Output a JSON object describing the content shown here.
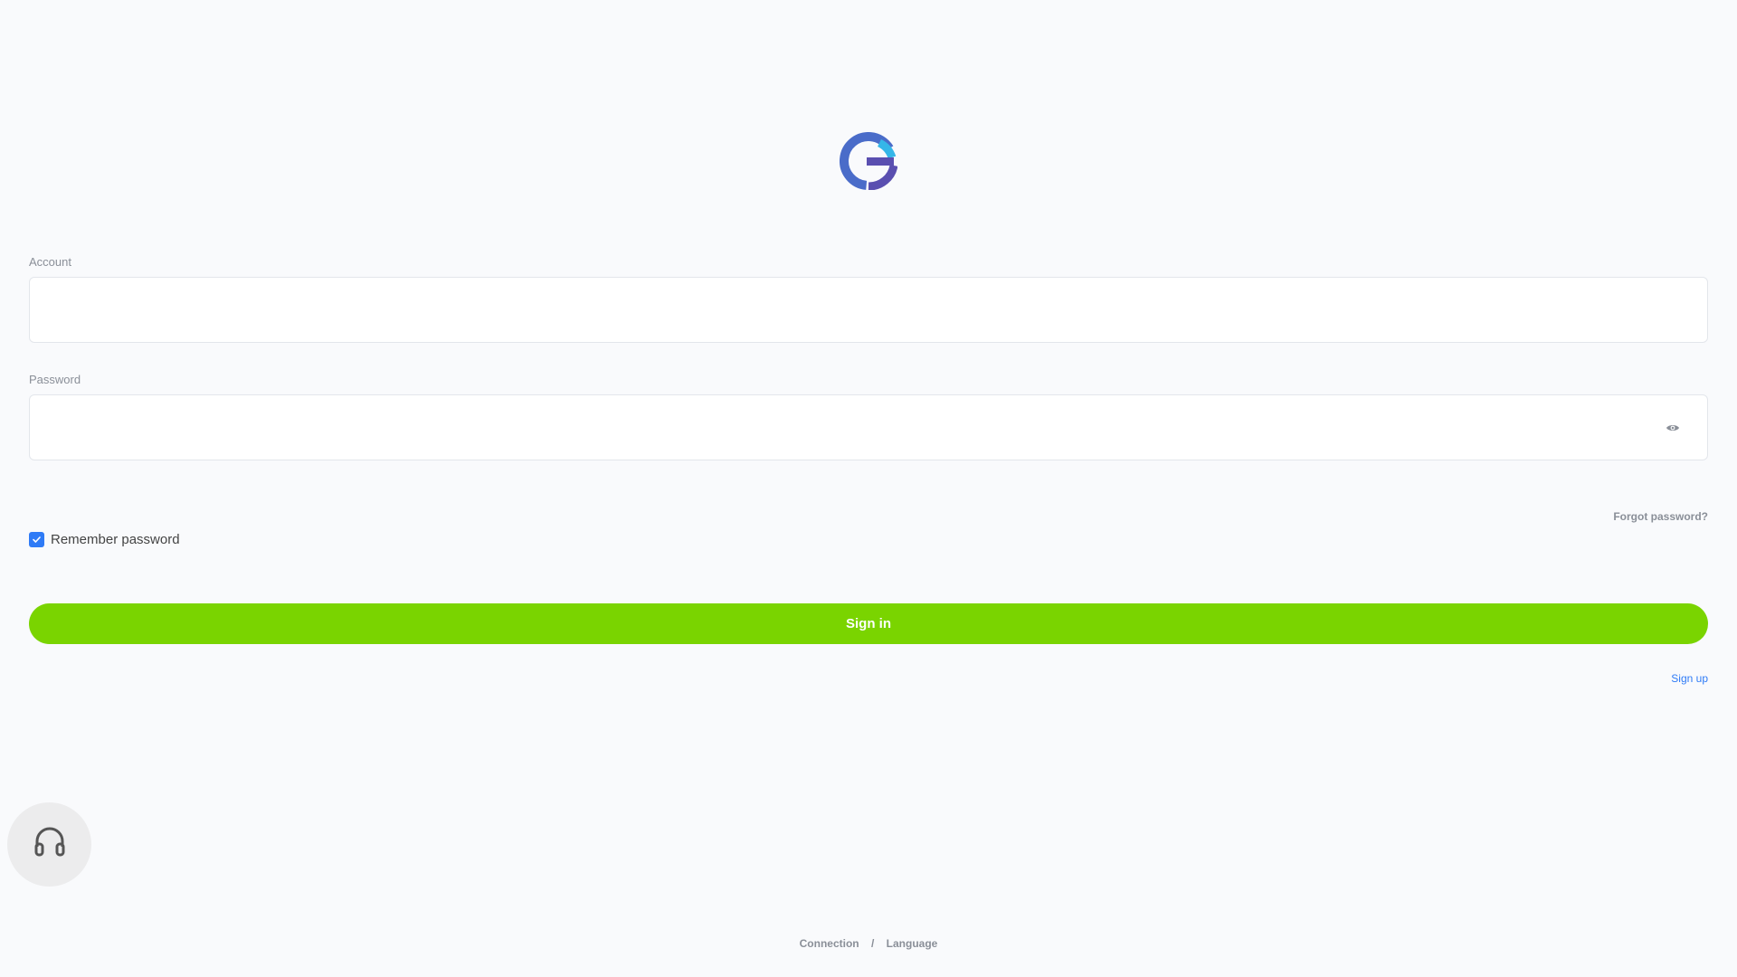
{
  "brand": {
    "logo_icon": "g-logo-icon",
    "colors": {
      "blue": "#4a6cc9",
      "cyan": "#35b6e8",
      "purple": "#5a4fb0"
    }
  },
  "login": {
    "account": {
      "label": "Account",
      "value": "",
      "placeholder": ""
    },
    "password": {
      "label": "Password",
      "value": "",
      "placeholder": "",
      "toggle_icon": "eye-icon"
    },
    "forgot_password": "Forgot password?",
    "remember_password": {
      "label": "Remember password",
      "checked": true
    },
    "sign_in": "Sign in",
    "sign_up": "Sign up"
  },
  "support": {
    "icon": "headphones-icon"
  },
  "footer": {
    "connection": "Connection",
    "separator": "/",
    "language": "Language"
  },
  "colors": {
    "background": "#f9fafc",
    "accent_green": "#7ad400",
    "accent_blue": "#2f7bf6",
    "muted_text": "#8a8f98"
  }
}
